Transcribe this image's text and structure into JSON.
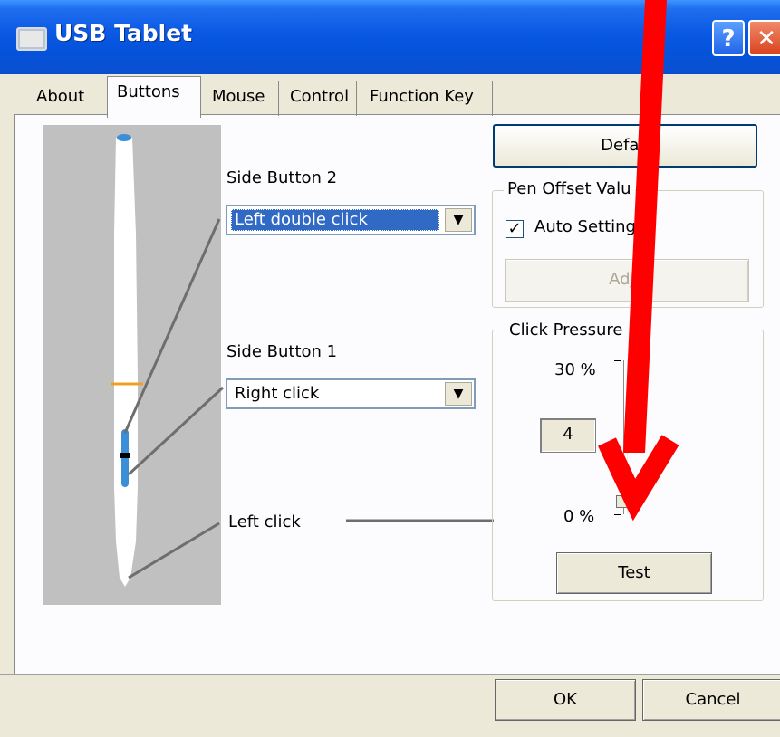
{
  "window": {
    "title": "USB Tablet",
    "help_label": "?",
    "close_label": "✕"
  },
  "tabs": [
    {
      "label": "About",
      "active": false
    },
    {
      "label": "Buttons",
      "active": true
    },
    {
      "label": "Mouse",
      "active": false
    },
    {
      "label": "Control",
      "active": false
    },
    {
      "label": "Function Key",
      "active": false
    }
  ],
  "buttons_tab": {
    "side_button_2": {
      "label": "Side Button 2",
      "value": "Left double click"
    },
    "side_button_1": {
      "label": "Side Button 1",
      "value": "Right click"
    },
    "tip": {
      "label": "Left click"
    },
    "default_button": "Defau",
    "pen_offset": {
      "group_label": "Pen Offset Valu",
      "auto_setting_label": "Auto Setting",
      "auto_setting_checked": true,
      "adjust_button": "Adju"
    },
    "click_pressure": {
      "group_label": "Click Pressure",
      "max_label": "30 %",
      "min_label": "0 %",
      "value": "4",
      "slider_level": 0.04,
      "test_button": "Test"
    }
  },
  "footer": {
    "ok_label": "OK",
    "cancel_label": "Cancel"
  },
  "colors": {
    "titlebar": "#0a58e3",
    "selection": "#316ac5",
    "annotation_arrow": "#ff0000",
    "pen_accent_blue": "#3a8fd8",
    "pen_accent_orange": "#f0a020"
  },
  "icons": {
    "window": "window-icon",
    "dropdown": "chevron-down-icon",
    "check": "checkmark-icon"
  }
}
